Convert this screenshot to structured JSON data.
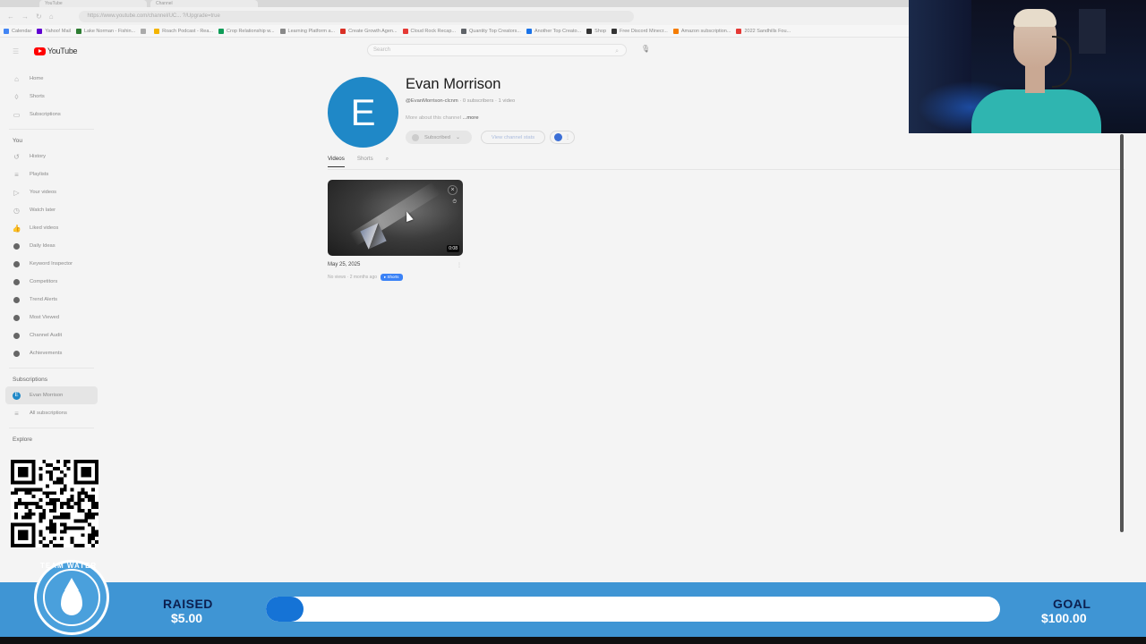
{
  "browser": {
    "tabs": [
      "YouTube",
      "Channel"
    ],
    "url": "https://www.youtube.com/channel/UC... ?/Upgrade=true",
    "bookmarks": [
      {
        "label": "Calendar",
        "color": "#4285f4"
      },
      {
        "label": "Yahoo! Mail",
        "color": "#6001d2"
      },
      {
        "label": "Lake Norman - Fishin...",
        "color": "#2e7d32"
      },
      {
        "label": "",
        "color": "#aaaaaa"
      },
      {
        "label": "Roach Podcast - Rea...",
        "color": "#f4b400"
      },
      {
        "label": "Crop Relationship w...",
        "color": "#0f9d58"
      },
      {
        "label": "Learning Platform a...",
        "color": "#888888"
      },
      {
        "label": "Create Growth Agen...",
        "color": "#d93025"
      },
      {
        "label": "Cloud Rock Recap...",
        "color": "#e53935"
      },
      {
        "label": "Quantity Top Creators...",
        "color": "#5f6368"
      },
      {
        "label": "Another Top Creato...",
        "color": "#1a73e8"
      },
      {
        "label": "Shop",
        "color": "#333333"
      },
      {
        "label": "Free Discord Minecr...",
        "color": "#333333"
      },
      {
        "label": "Amazon subscription...",
        "color": "#f57c00"
      },
      {
        "label": "2022 Sandhills Fou...",
        "color": "#e53935"
      }
    ]
  },
  "youtube": {
    "logo_text": "YouTube",
    "search_placeholder": "Search",
    "sidebar_main": [
      {
        "label": "Home",
        "icon": "home-icon",
        "glyph": "⌂"
      },
      {
        "label": "Shorts",
        "icon": "shorts-icon",
        "glyph": "◊"
      },
      {
        "label": "Subscriptions",
        "icon": "subscriptions-icon",
        "glyph": "▭"
      }
    ],
    "you_heading": "You",
    "sidebar_you": [
      {
        "label": "History",
        "icon": "history-icon",
        "glyph": "↺"
      },
      {
        "label": "Playlists",
        "icon": "playlists-icon",
        "glyph": "≡"
      },
      {
        "label": "Your videos",
        "icon": "your-videos-icon",
        "glyph": "▷"
      },
      {
        "label": "Watch later",
        "icon": "watch-later-icon",
        "glyph": "◷"
      },
      {
        "label": "Liked videos",
        "icon": "liked-videos-icon",
        "glyph": "👍"
      }
    ],
    "sidebar_tools": [
      {
        "label": "Daily Ideas"
      },
      {
        "label": "Keyword Inspector"
      },
      {
        "label": "Competitors"
      },
      {
        "label": "Trend Alerts"
      },
      {
        "label": "Most Viewed"
      },
      {
        "label": "Channel Audit"
      },
      {
        "label": "Achievements"
      }
    ],
    "subscriptions_heading": "Subscriptions",
    "subscriptions": [
      {
        "label": "Evan Morrison"
      },
      {
        "label": "All subscriptions"
      }
    ],
    "explore_heading": "Explore"
  },
  "channel": {
    "avatar_letter": "E",
    "name": "Evan Morrison",
    "handle": "@EvanMorrison-clcnm",
    "subscribers": "0 subscribers",
    "videos": "1 video",
    "description": "More about this channel",
    "description_more": "...more",
    "subscribed_label": "Subscribed",
    "join_label": "View channel stats",
    "tabs": [
      "Videos",
      "Shorts"
    ],
    "active_tab": "Videos"
  },
  "video": {
    "title": "May 25, 2025",
    "meta": "No views · 2 months ago",
    "badge": "▸ Shorts",
    "duration": "0:08",
    "watch_later": "⏱"
  },
  "overlay": {
    "raised_label": "RAISED",
    "raised_value": "$5.00",
    "goal_label": "GOAL",
    "goal_value": "$100.00",
    "progress_fraction": 0.05,
    "logo_text": "TEAM WATER",
    "colors": {
      "banner": "#3f95d4",
      "fill": "#1573d6",
      "label": "#0c1f4f"
    }
  }
}
